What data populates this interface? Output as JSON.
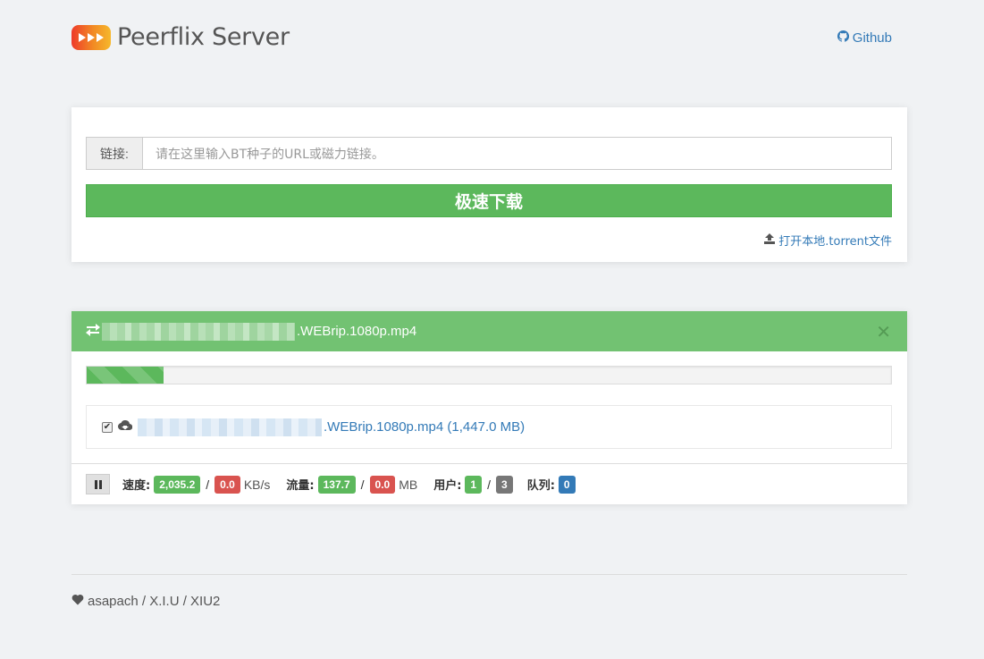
{
  "header": {
    "brand": "Peerflix Server",
    "github_label": "Github"
  },
  "form": {
    "input_label": "链接:",
    "input_placeholder": "请在这里输入BT种子的URL或磁力链接。",
    "download_label": "极速下载",
    "open_torrent_label": "打开本地.torrent文件"
  },
  "torrent": {
    "title_suffix": ".WEBrip.1080p.mp4",
    "progress_fraction": 0.096,
    "file": {
      "name_suffix": ".WEBrip.1080p.mp4",
      "size": "(1,447.0 MB)",
      "checked": true
    },
    "stats": {
      "speed_label": "速度:",
      "speed_down": "2,035.2",
      "speed_up": "0.0",
      "speed_unit": "KB/s",
      "traffic_label": "流量:",
      "traffic_down": "137.7",
      "traffic_up": "0.0",
      "traffic_unit": "MB",
      "users_label": "用户:",
      "users_active": "1",
      "users_total": "3",
      "queue_label": "队列:",
      "queue": "0",
      "slash": "/"
    }
  },
  "footer": {
    "credits": "asapach / X.I.U / XIU2"
  },
  "colors": {
    "primary_green": "#5cb85c",
    "header_green": "#72c272",
    "link_blue": "#337ab7",
    "badge_red": "#d9534f",
    "badge_gray": "#777777",
    "badge_blue": "#337ab7"
  }
}
